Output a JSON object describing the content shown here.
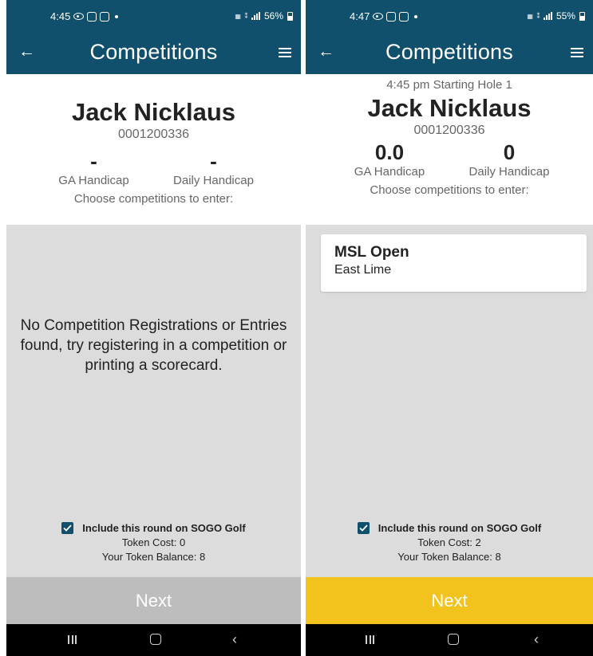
{
  "screens": [
    {
      "status_time": "4:45",
      "status_battery": "56%",
      "app_title": "Competitions",
      "start_line": "",
      "player_name": "Jack Nicklaus",
      "member_number": "0001200336",
      "ga_handicap_value": "-",
      "ga_handicap_label": "GA Handicap",
      "daily_handicap_value": "-",
      "daily_handicap_label": "Daily Handicap",
      "choose_text": "Choose competitions to enter:",
      "empty_message": "No Competition Registrations or Entries found, try registering in a competition or printing a scorecard.",
      "sogo_label": "Include this round on SOGO Golf",
      "sogo_checked": true,
      "token_cost": "Token Cost: 0",
      "token_balance": "Your Token Balance: 8",
      "next_label": "Next",
      "next_enabled": false,
      "next_color": "#bdbdbd"
    },
    {
      "status_time": "4:47",
      "status_battery": "55%",
      "app_title": "Competitions",
      "start_line": "4:45 pm Starting Hole 1",
      "player_name": "Jack Nicklaus",
      "member_number": "0001200336",
      "ga_handicap_value": "0.0",
      "ga_handicap_label": "GA Handicap",
      "daily_handicap_value": "0",
      "daily_handicap_label": "Daily Handicap",
      "choose_text": "Choose competitions to enter:",
      "competitions": [
        {
          "name": "MSL Open",
          "course": "East Lime"
        }
      ],
      "sogo_label": "Include this round on SOGO Golf",
      "sogo_checked": true,
      "token_cost": "Token Cost: 2",
      "token_balance": "Your Token Balance: 8",
      "next_label": "Next",
      "next_enabled": true,
      "next_color": "#f2c31c"
    }
  ],
  "colors": {
    "brand_bar": "#10506c",
    "content_bg": "#dcdcdc",
    "next_disabled": "#bdbdbd",
    "next_enabled": "#f2c31c"
  },
  "icons": {
    "back": "arrow-left-icon",
    "menu": "hamburger-menu-icon",
    "checkbox": "checkbox-checked-icon",
    "nav_recent": "recent-apps-icon",
    "nav_home": "home-icon",
    "nav_back": "nav-back-icon"
  }
}
